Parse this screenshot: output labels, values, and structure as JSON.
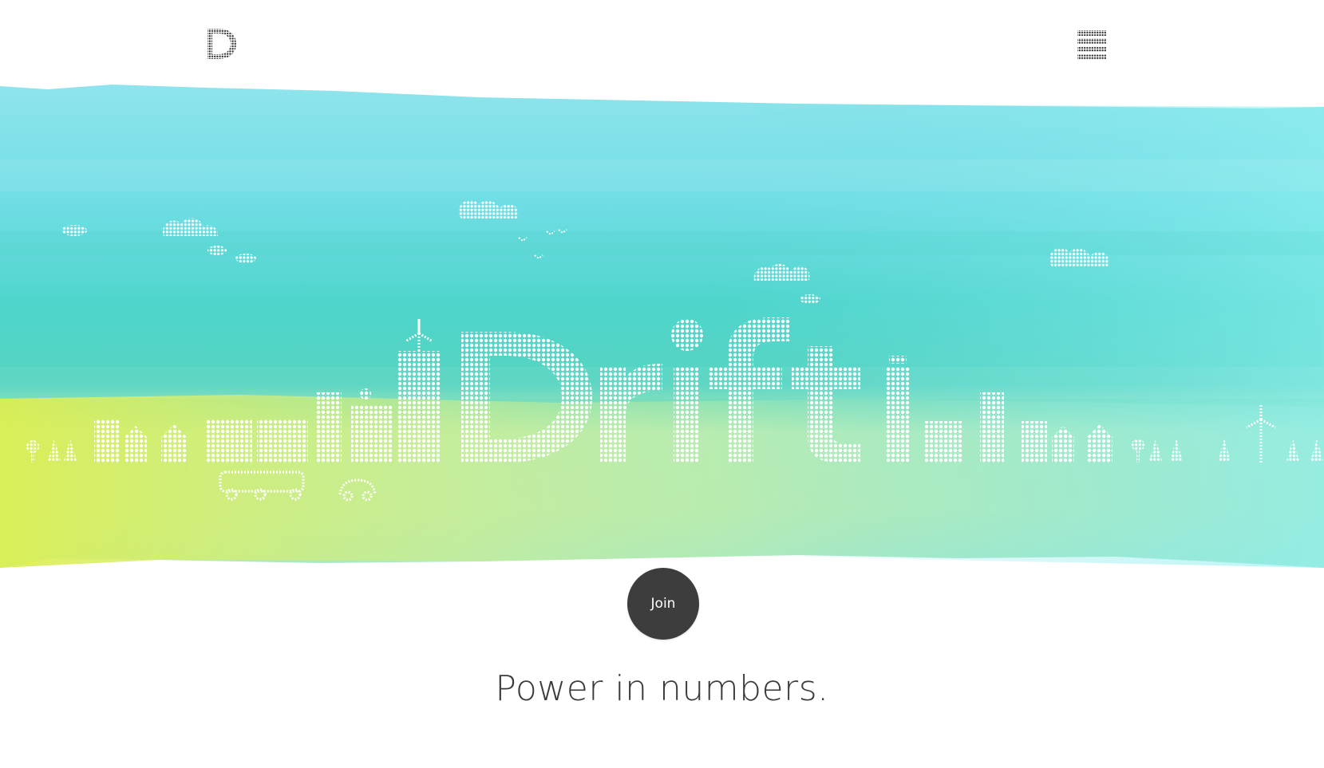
{
  "header": {
    "logo_icon": "dotted-d-logo-icon",
    "menu_icon": "hamburger-menu-icon"
  },
  "hero": {
    "brand_word": "Drifti",
    "illustration": "dotted-city-skyline-watercolor",
    "colors": {
      "cyan": "#7fe6ec",
      "teal": "#48d3c7",
      "lime": "#d6ee4a",
      "mint": "#a6e8c0"
    }
  },
  "cta": {
    "join_label": "Join",
    "button_color": "#3d3d3d"
  },
  "tagline": "Power in numbers."
}
